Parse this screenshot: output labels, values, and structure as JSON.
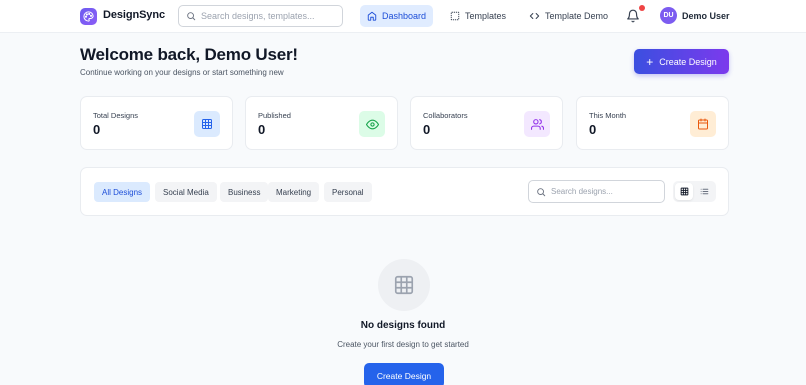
{
  "header": {
    "brand": "DesignSync",
    "search_placeholder": "Search designs, templates...",
    "nav": [
      {
        "label": "Dashboard",
        "icon": "home-icon",
        "active": true
      },
      {
        "label": "Templates",
        "icon": "layout-icon",
        "active": false
      },
      {
        "label": "Template Demo",
        "icon": "code-icon",
        "active": false
      }
    ],
    "notifications_unread": true,
    "user": {
      "initials": "DU",
      "name": "Demo User"
    }
  },
  "welcome": {
    "title": "Welcome back, Demo User!",
    "subtitle": "Continue working on your designs or start something new",
    "create_button": "Create Design"
  },
  "stats": [
    {
      "label": "Total Designs",
      "value": "0",
      "icon": "grid-icon",
      "color": "#2563eb"
    },
    {
      "label": "Published",
      "value": "0",
      "icon": "eye-icon",
      "color": "#16a34a"
    },
    {
      "label": "Collaborators",
      "value": "0",
      "icon": "users-icon",
      "color": "#9333ea"
    },
    {
      "label": "This Month",
      "value": "0",
      "icon": "calendar-icon",
      "color": "#ea580c"
    }
  ],
  "filters": {
    "categories": [
      "All Designs",
      "Social Media",
      "Business",
      "Marketing",
      "Personal"
    ],
    "active_category": "All Designs",
    "search_placeholder": "Search designs...",
    "view_mode": "grid"
  },
  "empty_state": {
    "title": "No designs found",
    "subtitle": "Create your first design to get started",
    "button": "Create Design"
  },
  "colors": {
    "accent": "#2563eb",
    "gradient_start": "#3b4fe0",
    "gradient_end": "#7c3aed",
    "notification": "#ef4444"
  }
}
